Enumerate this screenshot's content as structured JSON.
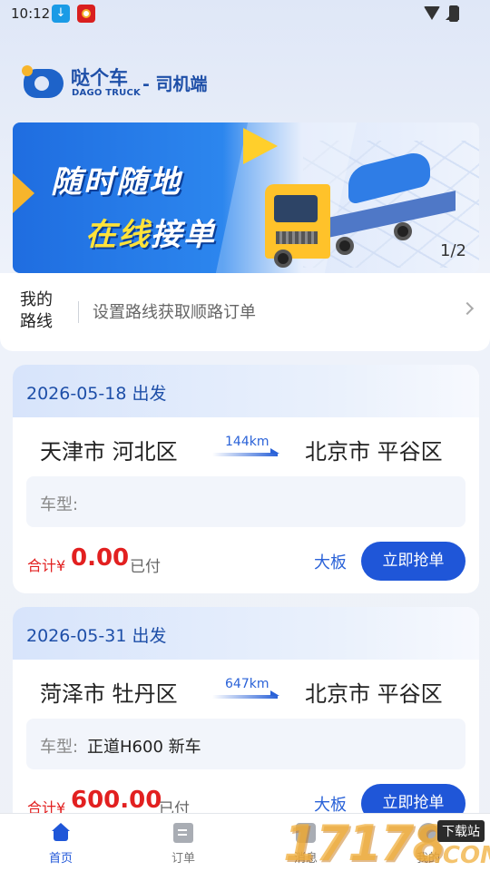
{
  "status_bar": {
    "time": "10:12"
  },
  "header": {
    "logo_title": "哒个车",
    "logo_subtitle": "DAGO TRUCK",
    "role_label": "- 司机端"
  },
  "banner": {
    "line1": "随时随地",
    "line2_highlight": "在线",
    "line2_rest": "接单",
    "pager": "1/2"
  },
  "route_card": {
    "title": "我的路线",
    "hint": "设置路线获取顺路订单"
  },
  "orders": [
    {
      "date_label": "2026-05-18 出发",
      "from": "天津市 河北区",
      "to": "北京市 平谷区",
      "distance": "144km",
      "vehicle_label": "车型:",
      "vehicle_value": "",
      "total_label": "合计¥",
      "total_amount": "0.00",
      "paid_label": "已付",
      "vehicle_type": "大板",
      "button_label": "立即抢单"
    },
    {
      "date_label": "2026-05-31 出发",
      "from": "菏泽市 牡丹区",
      "to": "北京市 平谷区",
      "distance": "647km",
      "vehicle_label": "车型:",
      "vehicle_value": "正道H600  新车",
      "total_label": "合计¥",
      "total_amount": "600.00",
      "paid_label": "已付",
      "vehicle_type": "大板",
      "button_label": "立即抢单"
    }
  ],
  "bottom_nav": {
    "items": [
      {
        "label": "首页",
        "icon": "home-icon",
        "active": true
      },
      {
        "label": "订单",
        "icon": "order-icon",
        "active": false
      },
      {
        "label": "消息",
        "icon": "message-icon",
        "active": false
      },
      {
        "label": "我的",
        "icon": "profile-icon",
        "active": false
      }
    ]
  },
  "watermark": {
    "number": "17178",
    "tag": "下载站",
    "domain": ".COM"
  },
  "colors": {
    "brand_blue": "#1f56d8",
    "price_red": "#e22020",
    "logo_navy": "#1e4fa8"
  }
}
